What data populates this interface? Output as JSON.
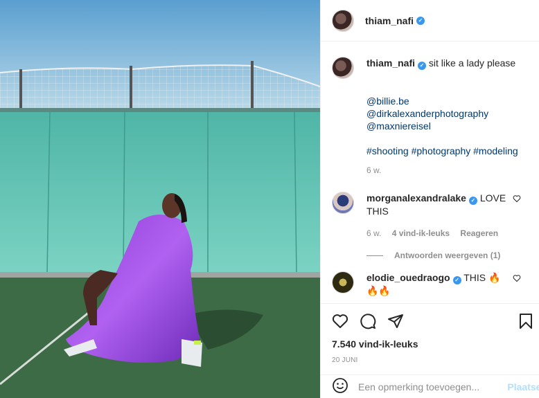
{
  "post": {
    "username": "thiam_nafi",
    "verified_mark": "✓",
    "caption_text": "sit like a lady please",
    "mentions": [
      "@billie.be",
      "@dirkalexanderphotography",
      "@maxniereisel"
    ],
    "hashtags": "#shooting #photography #modeling",
    "caption_time": "6 w."
  },
  "comments": [
    {
      "username": "morganalexandralake",
      "text": "LOVE THIS",
      "time": "6 w.",
      "likes": "4 vind-ik-leuks",
      "reply": "Reageren",
      "view_replies": "Antwoorden weergeven (1)"
    },
    {
      "username": "elodie_ouedraogo",
      "text": "THIS 🔥🔥🔥"
    }
  ],
  "footer": {
    "likes_count": "7.540 vind-ik-leuks",
    "date": "20 JUNI",
    "comment_placeholder": "Een opmerking toevoegen...",
    "post_button": "Plaatsen"
  },
  "colors": {
    "verified": "#3897f0",
    "link": "#00376b",
    "muted": "#8e8e8e",
    "post_button": "#b2dffc"
  },
  "icons": [
    "heart-icon",
    "comment-icon",
    "share-icon",
    "bookmark-icon",
    "emoji-icon"
  ]
}
